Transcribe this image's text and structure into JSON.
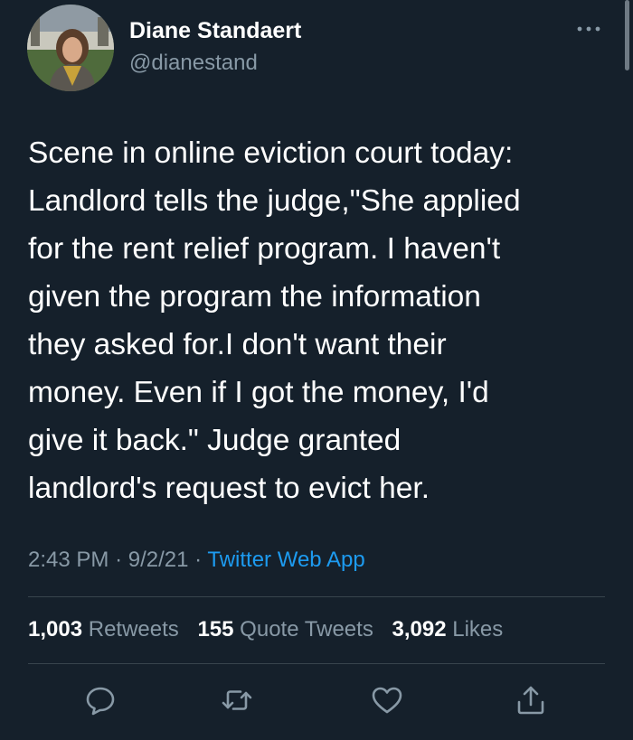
{
  "author": {
    "name": "Diane Standaert",
    "handle": "@dianestand"
  },
  "tweet": {
    "text": "Scene in online eviction court today:\nLandlord tells the judge,\"She applied\nfor the rent relief program. I haven't\ngiven the program the information\nthey asked for.I don't want their\nmoney. Even if I got the money, I'd\ngive it back.\" Judge granted\nlandlord's request to evict her.",
    "time": "2:43 PM",
    "date": "9/2/21",
    "separator": "·",
    "source": "Twitter Web App"
  },
  "stats": {
    "retweets_count": "1,003",
    "retweets_label": "Retweets",
    "quotes_count": "155",
    "quotes_label": "Quote Tweets",
    "likes_count": "3,092",
    "likes_label": "Likes"
  },
  "icons": {
    "more": "more-horizontal-icon",
    "reply": "reply-icon",
    "retweet": "retweet-icon",
    "like": "heart-icon",
    "share": "share-icon"
  },
  "colors": {
    "background": "#15202b",
    "text": "#ffffff",
    "secondary": "#8899a6",
    "link": "#1d9bf0",
    "divider": "#38444d"
  }
}
